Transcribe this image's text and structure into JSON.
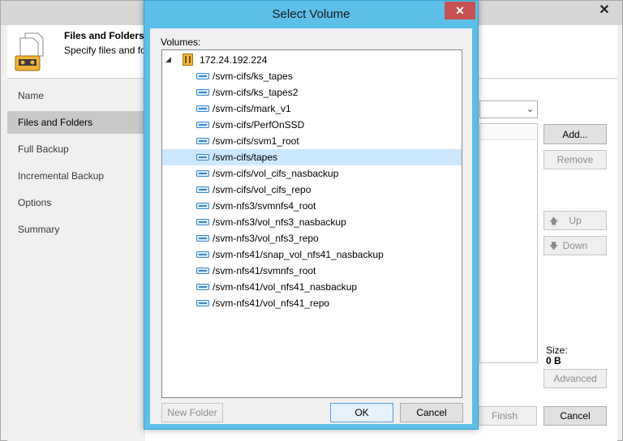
{
  "wizard": {
    "close_glyph": "✕",
    "header": {
      "title": "Files and Folders",
      "subtitle": "Specify files and fo",
      "icon": "files-folders-tape-icon"
    },
    "steps": [
      {
        "label": "Name",
        "active": false
      },
      {
        "label": "Files and Folders",
        "active": true
      },
      {
        "label": "Full Backup",
        "active": false
      },
      {
        "label": "Incremental Backup",
        "active": false
      },
      {
        "label": "Options",
        "active": false
      },
      {
        "label": "Summary",
        "active": false
      }
    ],
    "buttons": {
      "add": "Add...",
      "remove": "Remove",
      "up": "Up",
      "down": "Down",
      "advanced": "Advanced",
      "finish": "Finish",
      "cancel": "Cancel"
    },
    "size": {
      "label": "Size:",
      "value": "0 B"
    }
  },
  "dialog": {
    "title": "Select Volume",
    "close_glyph": "✕",
    "volumes_label": "Volumes:",
    "server": "172.24.192.224",
    "volumes": [
      "/svm-cifs/ks_tapes",
      "/svm-cifs/ks_tapes2",
      "/svm-cifs/mark_v1",
      "/svm-cifs/PerfOnSSD",
      "/svm-cifs/svm1_root",
      "/svm-cifs/tapes",
      "/svm-cifs/vol_cifs_nasbackup",
      "/svm-cifs/vol_cifs_repo",
      "/svm-nfs3/svmnfs4_root",
      "/svm-nfs3/vol_nfs3_nasbackup",
      "/svm-nfs3/vol_nfs3_repo",
      "/svm-nfs41/snap_vol_nfs41_nasbackup",
      "/svm-nfs41/svmnfs_root",
      "/svm-nfs41/vol_nfs41_nasbackup",
      "/svm-nfs41/vol_nfs41_repo"
    ],
    "selected_volume": "/svm-cifs/tapes",
    "buttons": {
      "new_folder": "New Folder",
      "ok": "OK",
      "cancel": "Cancel"
    }
  },
  "colors": {
    "dialog_frame": "#5bbfe8",
    "selection": "#cce8ff",
    "close_button": "#c75050"
  }
}
